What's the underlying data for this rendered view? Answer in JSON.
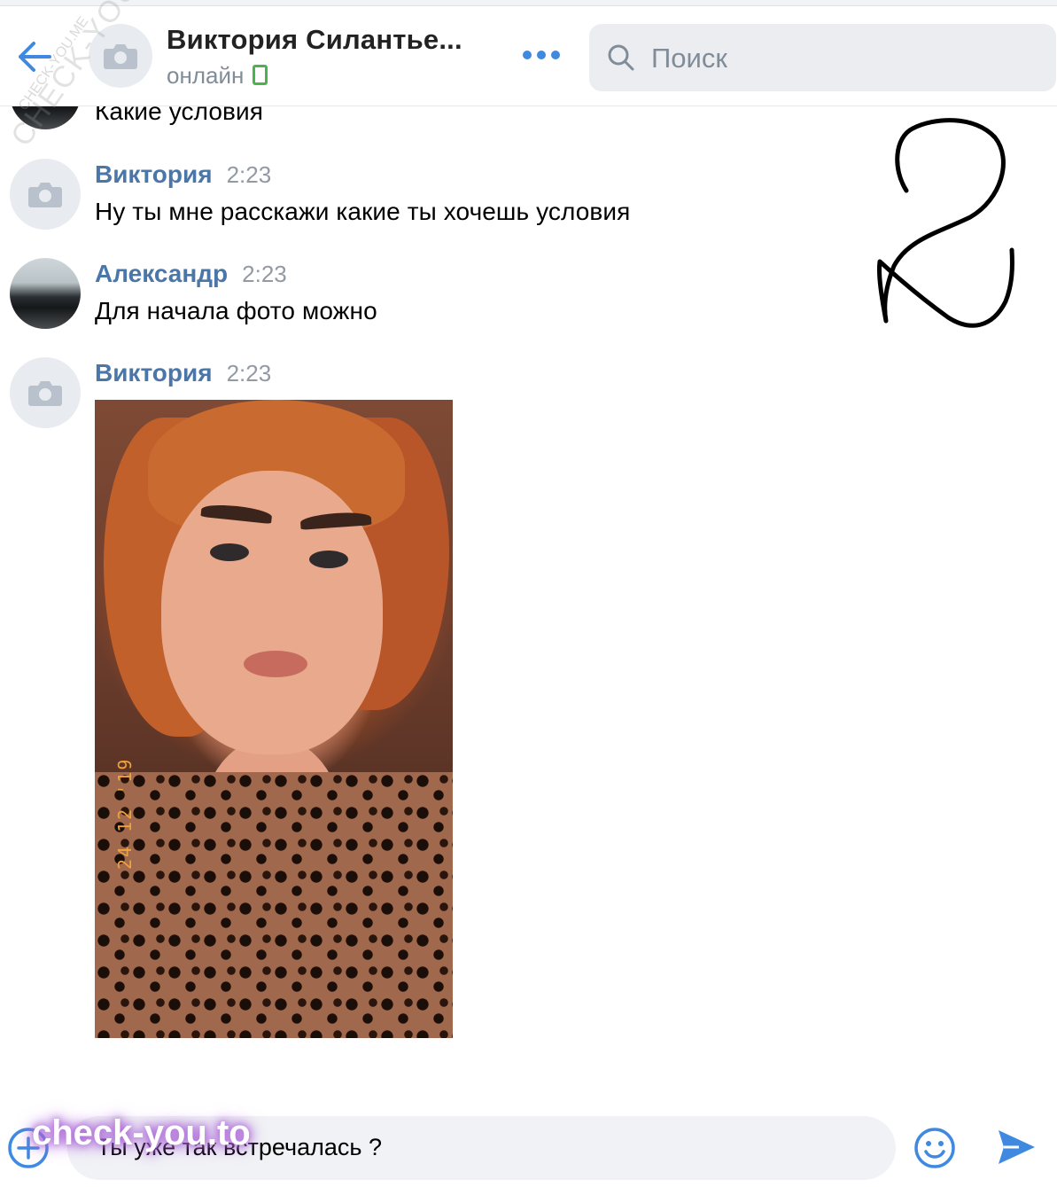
{
  "header": {
    "title": "Виктория Силантье...",
    "status": "онлайн",
    "search_placeholder": "Поиск"
  },
  "messages": [
    {
      "author": "",
      "time": "",
      "text": "Какие условия"
    },
    {
      "author": "Виктория",
      "time": "2:23",
      "text": "Ну ты мне расскажи какие ты хочешь условия"
    },
    {
      "author": "Александр",
      "time": "2:23",
      "text": "Для начала фото можно"
    },
    {
      "author": "Виктория",
      "time": "2:23",
      "text": ""
    }
  ],
  "photo": {
    "date_stamp": "24 12 '19"
  },
  "composer": {
    "value": "Ты уже так встречалась ?"
  },
  "overlays": {
    "watermark_diagonal": "CHECK-YOU.ME",
    "watermark_small": "CHECK-YOU.ME",
    "watermark_bottom": "check-you.to",
    "handwritten_number": "2"
  },
  "colors": {
    "accent": "#4a76a8",
    "online": "#4bb34b",
    "time": "#939aa3",
    "input_bg": "#f0f2f5",
    "send": "#3f8ae0"
  },
  "icons": [
    "back-arrow-icon",
    "camera-icon",
    "online-mobile-icon",
    "more-dots-icon",
    "search-icon",
    "attach-plus-icon",
    "emoji-icon",
    "send-icon"
  ]
}
